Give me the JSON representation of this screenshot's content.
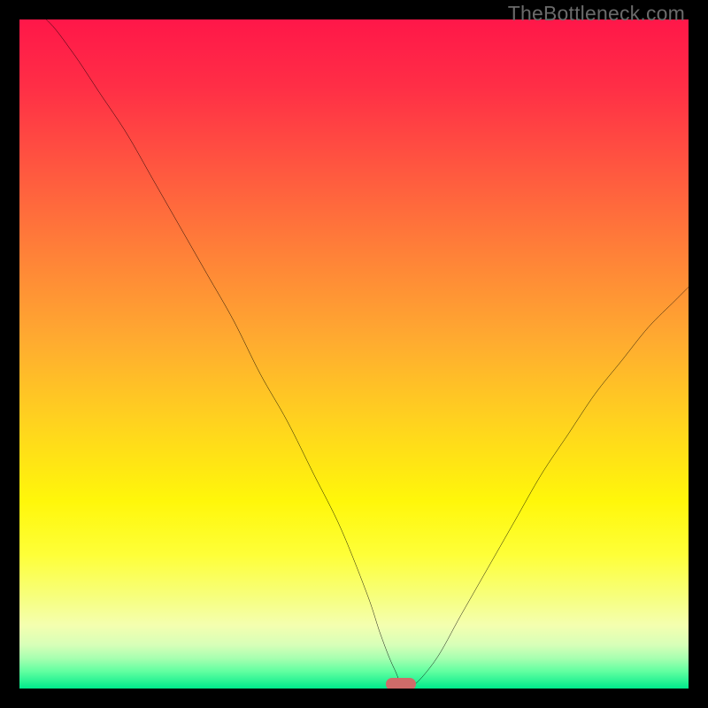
{
  "watermark": "TheBottleneck.com",
  "chart_data": {
    "type": "line",
    "title": "",
    "xlabel": "",
    "ylabel": "",
    "xlim": [
      0,
      100
    ],
    "ylim": [
      0,
      100
    ],
    "series": [
      {
        "name": "bottleneck-curve",
        "x": [
          0,
          4,
          8,
          12,
          16,
          20,
          24,
          28,
          32,
          36,
          40,
          44,
          48,
          52,
          54,
          56,
          58,
          62,
          66,
          70,
          74,
          78,
          82,
          86,
          90,
          94,
          98,
          100
        ],
        "y": [
          102,
          100,
          95,
          89,
          83,
          76,
          69,
          62,
          55,
          47,
          40,
          32,
          24,
          14,
          8,
          3,
          0,
          4,
          11,
          18,
          25,
          32,
          38,
          44,
          49,
          54,
          58,
          60
        ]
      }
    ],
    "marker": {
      "x": 57,
      "y": 0
    },
    "gradient_stops": [
      {
        "offset": 0.0,
        "color": "#ff1749"
      },
      {
        "offset": 0.1,
        "color": "#ff2e46"
      },
      {
        "offset": 0.22,
        "color": "#ff5640"
      },
      {
        "offset": 0.35,
        "color": "#ff8138"
      },
      {
        "offset": 0.48,
        "color": "#ffab30"
      },
      {
        "offset": 0.6,
        "color": "#ffd21f"
      },
      {
        "offset": 0.72,
        "color": "#fff70a"
      },
      {
        "offset": 0.8,
        "color": "#feff38"
      },
      {
        "offset": 0.86,
        "color": "#f7ff7a"
      },
      {
        "offset": 0.905,
        "color": "#f4ffaf"
      },
      {
        "offset": 0.935,
        "color": "#d7ffb8"
      },
      {
        "offset": 0.955,
        "color": "#a6ffb0"
      },
      {
        "offset": 0.975,
        "color": "#5fffa0"
      },
      {
        "offset": 1.0,
        "color": "#00e98b"
      }
    ]
  }
}
